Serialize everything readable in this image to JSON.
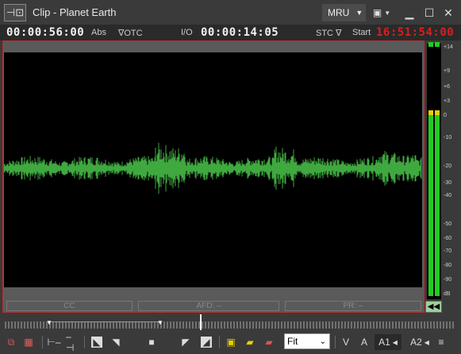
{
  "window": {
    "title": "Clip - Planet Earth",
    "mru_label": "MRU"
  },
  "timecodes": {
    "position": "00:00:56:00",
    "position_mode": "Abs",
    "otc_label": "OTC",
    "io_label": "I/O",
    "io_value": "00:00:14:05",
    "stc_label": "STC",
    "start_label": "Start",
    "start_value": "16:51:54:00"
  },
  "badges": {
    "cc": "CC",
    "afd": "AFD: –",
    "pr": "PR: –"
  },
  "meter": {
    "scale": [
      "+14",
      "+9",
      "+6",
      "+3",
      "0",
      "-10",
      "-20",
      "-30",
      "-40",
      "-50",
      "-60",
      "-70",
      "-80",
      "-90",
      "dB"
    ]
  },
  "toolbar": {
    "zoom": "Fit",
    "v_label": "V",
    "a_label": "A",
    "a1_label": "A1",
    "a2_label": "A2"
  },
  "colors": {
    "waveform": "#3fa83f",
    "meter_green": "#22cc22",
    "meter_yellow": "#e8d000",
    "start_tc": "#d62020",
    "border_active": "#b33030"
  }
}
